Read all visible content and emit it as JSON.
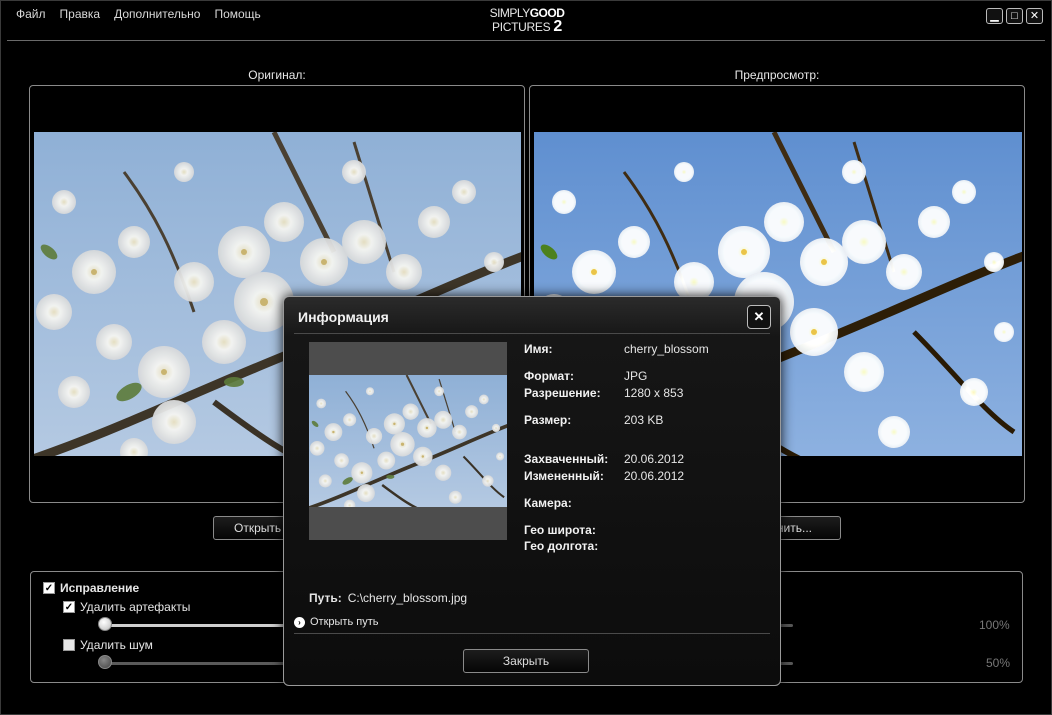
{
  "menu": {
    "items": [
      "Файл",
      "Правка",
      "Дополнительно",
      "Помощь"
    ]
  },
  "logo": {
    "line1_a": "SIMPLY",
    "line1_b": "GOOD",
    "line2_a": "PICTURES",
    "line2_b": "2"
  },
  "window": {
    "minimize": "▁",
    "maximize": "□",
    "close": "✕"
  },
  "panels": {
    "original_label": "Оригинал:",
    "preview_label": "Предпросмотр:"
  },
  "buttons": {
    "open": "Открыть",
    "save_suffix": "нить..."
  },
  "correction": {
    "title": "Исправление",
    "title_checked": true,
    "remove_artifacts": "Удалить артефакты",
    "remove_artifacts_checked": true,
    "remove_noise": "Удалить шум",
    "remove_noise_checked": false,
    "artifacts_pct": "100%",
    "noise_pct": "50%"
  },
  "dialog": {
    "title": "Информация",
    "close": "✕",
    "fields": [
      {
        "label": "Имя:",
        "value": "cherry_blossom"
      },
      {
        "label": "Формат:",
        "value": "JPG"
      },
      {
        "label": "Разрешение:",
        "value": "1280 x 853"
      },
      {
        "label": "Размер:",
        "value": "203 KB"
      },
      {
        "label": "Захваченный:",
        "value": "20.06.2012"
      },
      {
        "label": "Измененный:",
        "value": "20.06.2012"
      },
      {
        "label": "Камера:",
        "value": ""
      },
      {
        "label": "Гео широта:",
        "value": ""
      },
      {
        "label": "Гео долгота:",
        "value": ""
      }
    ],
    "path_label": "Путь:",
    "path_value": "C:\\cherry_blossom.jpg",
    "open_path": "Открыть путь",
    "close_button": "Закрыть"
  },
  "colors": {
    "background": "#000000",
    "border": "#8a8a8a",
    "sky": "#7fa6d4",
    "blossom": "#f2f2ee"
  },
  "icons": {
    "checkbox": "check-icon",
    "open_path": "arrow-right-circle-icon",
    "close": "close-icon"
  }
}
